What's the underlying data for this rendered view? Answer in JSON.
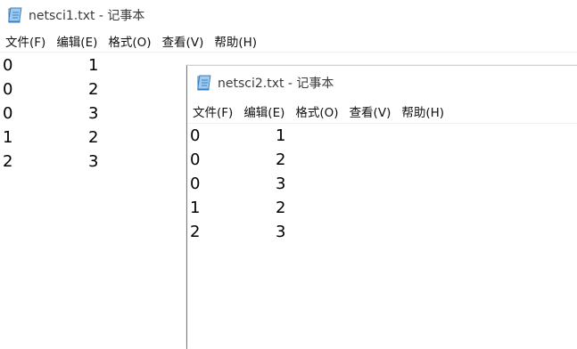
{
  "window1": {
    "title": "netsci1.txt - 记事本",
    "menu": [
      "文件(F)",
      "编辑(E)",
      "格式(O)",
      "查看(V)",
      "帮助(H)"
    ],
    "lines": [
      [
        "0",
        "1"
      ],
      [
        "0",
        "2"
      ],
      [
        "0",
        "3"
      ],
      [
        "1",
        "2"
      ],
      [
        "2",
        "3"
      ]
    ]
  },
  "window2": {
    "title": "netsci2.txt - 记事本",
    "menu": [
      "文件(F)",
      "编辑(E)",
      "格式(O)",
      "查看(V)",
      "帮助(H)"
    ],
    "lines": [
      [
        "0",
        "1"
      ],
      [
        "0",
        "2"
      ],
      [
        "0",
        "3"
      ],
      [
        "1",
        "2"
      ],
      [
        "2",
        "3"
      ]
    ]
  },
  "icons": {
    "app": "notepad-icon"
  },
  "colors": {
    "title_text": "#3a3a3a",
    "icon_blue": "#5aa0d8"
  }
}
